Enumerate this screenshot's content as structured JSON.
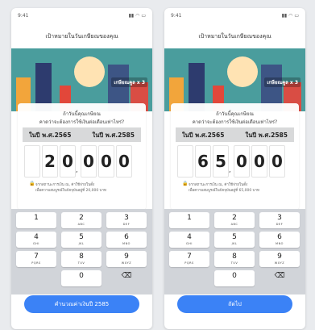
{
  "screens": [
    {
      "status_time": "9:41",
      "title": "เป้าหมายในวันเกษียณของคุณ",
      "banner_tag": "เกษียณคูล x 3",
      "question_line1": "ถ้าวันนี้คุณเกษียณ",
      "question_line2": "คาดว่าจะต้องการใช้เงินต่อเดือนเท่าไหร่?",
      "year_left": "ในปี พ.ศ.2565",
      "year_right": "ในปี พ.ศ.2585",
      "digits": [
        "2",
        "0",
        "0",
        "0",
        "0"
      ],
      "note_line1": "จากสถานะการเงิน ณ, ค่าใช้จ่ายในตั้ง",
      "note_line2": "เพื่อความสมบูรณ์ในปัจจุบันอยู่ที่ 20,000 บาท",
      "cta": "คำนวณค่าเงินปี 2585"
    },
    {
      "status_time": "9:41",
      "title": "เป้าหมายในวันเกษียณของคุณ",
      "banner_tag": "เกษียณคูล x 3",
      "question_line1": "ถ้าวันนี้คุณเกษียณ",
      "question_line2": "คาดว่าจะต้องการใช้เงินต่อเดือนเท่าไหร่?",
      "year_left": "ในปี พ.ศ.2565",
      "year_right": "ในปี พ.ศ.2585",
      "digits": [
        "6",
        "5",
        "0",
        "0",
        "0"
      ],
      "note_line1": "จากสถานะการเงิน ณ, ค่าใช้จ่ายในตั้ง",
      "note_line2": "เพื่อความสมบูรณ์ในปัจจุบันอยู่ที่ 65,000 บาท",
      "cta": "ถัดไป"
    }
  ],
  "keypad": [
    {
      "num": "1",
      "letters": ""
    },
    {
      "num": "2",
      "letters": "ABC"
    },
    {
      "num": "3",
      "letters": "DEF"
    },
    {
      "num": "4",
      "letters": "GHI"
    },
    {
      "num": "5",
      "letters": "JKL"
    },
    {
      "num": "6",
      "letters": "MNO"
    },
    {
      "num": "7",
      "letters": "PQRS"
    },
    {
      "num": "8",
      "letters": "TUV"
    },
    {
      "num": "9",
      "letters": "WXYZ"
    },
    {
      "num": "0",
      "letters": ""
    }
  ],
  "icons": {
    "signal": "signal-icon",
    "wifi": "wifi-icon",
    "battery": "battery-icon",
    "delete": "backspace-icon",
    "lock": "lock-icon"
  },
  "colors": {
    "primary": "#3b82f6",
    "keypad_bg": "#d1d4d9",
    "banner_teal": "#4a9d9d"
  }
}
